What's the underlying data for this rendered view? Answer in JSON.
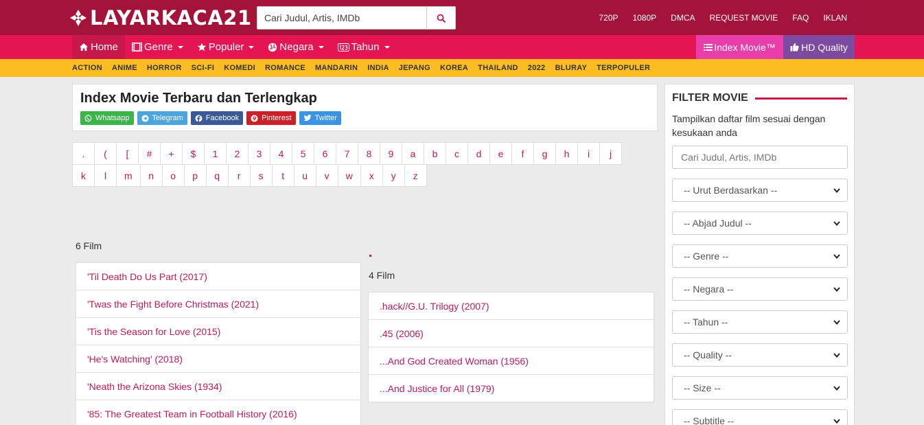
{
  "brand": {
    "logo_text": "LAYARKACA21",
    "accent": "#a3133a"
  },
  "search": {
    "placeholder": "Cari Judul, Artis, IMDb"
  },
  "top_links": [
    "720P",
    "1080P",
    "DMCA",
    "REQUEST MOVIE",
    "FAQ",
    "IKLAN"
  ],
  "nav": {
    "home": "Home",
    "genre": "Genre",
    "populer": "Populer",
    "negara": "Negara",
    "tahun": "Tahun",
    "index_movie": "Index Movie™",
    "hd_quality": "HD Quality"
  },
  "genres": [
    "ACTION",
    "ANIME",
    "HORROR",
    "SCI-FI",
    "KOMEDI",
    "ROMANCE",
    "MANDARIN",
    "INDIA",
    "JEPANG",
    "KOREA",
    "THAILAND",
    "2022",
    "BLURAY",
    "TERPOPULER"
  ],
  "index": {
    "title": "Index Movie Terbaru dan Terlengkap",
    "share": [
      "Whatsapp",
      "Telegram",
      "Facebook",
      "Pinterest",
      "Twitter"
    ]
  },
  "alphabet": [
    ".",
    "(",
    "[",
    "#",
    "+",
    "$",
    "1",
    "2",
    "3",
    "4",
    "5",
    "6",
    "7",
    "8",
    "9",
    "a",
    "b",
    "c",
    "d",
    "e",
    "f",
    "g",
    "h",
    "i",
    "j",
    "k",
    "l",
    "m",
    "n",
    "o",
    "p",
    "q",
    "r",
    "s",
    "t",
    "u",
    "v",
    "w",
    "x",
    "y",
    "z"
  ],
  "list1": {
    "count": "6 Film",
    "films": [
      "'Til Death Do Us Part (2017)",
      "'Twas the Fight Before Christmas (2021)",
      "'Tis the Season for Love (2015)",
      "'He's Watching' (2018)",
      "'Neath the Arizona Skies (1934)",
      "'85: The Greatest Team in Football History (2016)"
    ]
  },
  "list2": {
    "count": "4 Film",
    "films": [
      ".hack//G.U. Trilogy (2007)",
      ".45 (2006)",
      "...And God Created Woman (1956)",
      "...And Justice for All (1979)"
    ]
  },
  "filter": {
    "title": "FILTER MOVIE",
    "description": "Tampilkan daftar film sesuai dengan kesukaan anda",
    "search_placeholder": "Cari Judul, Artis, IMDb",
    "selects": [
      "-- Urut Berdasarkan --",
      "-- Abjad Judul --",
      "-- Genre --",
      "-- Negara --",
      "-- Tahun --",
      "-- Quality --",
      "-- Size --",
      "-- Subtitle --"
    ]
  }
}
